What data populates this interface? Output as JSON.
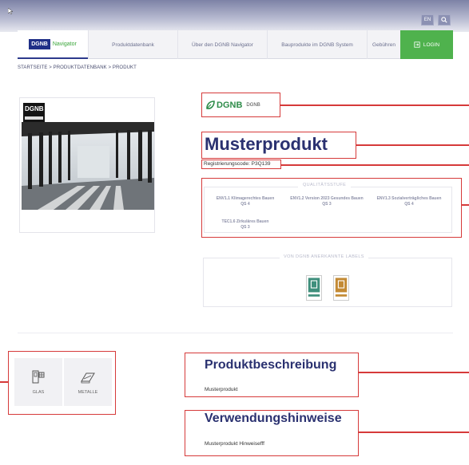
{
  "topbar": {
    "lang": "EN",
    "search_icon": "search-icon"
  },
  "nav": {
    "logo_text": "DGNB",
    "logo_sub": "Navigator",
    "items": [
      "Produktdatenbank",
      "Über den DGNB Navigator",
      "Bauprodukte im DGNB System",
      "Gebühren"
    ],
    "login": "LOGIN"
  },
  "breadcrumb": "STARTSEITE  >  PRODUKTDATENBANK  >  PRODUKT",
  "image_card": {
    "badge_text": "DGNB"
  },
  "brand": {
    "logo": "DGNB",
    "name": "DGNB"
  },
  "product": {
    "title": "Musterprodukt",
    "registration": "Registrierungscode: P3Q139"
  },
  "quality": {
    "label": "QUALITÄTSSTUFE",
    "items": [
      {
        "name": "ENV1.1 Klimagerechtes Bauen",
        "level": "QS 4"
      },
      {
        "name": "ENV1.2 Version 2023 Gesundes Bauen",
        "level": "QS 3"
      },
      {
        "name": "ENV1.3 Sozialverträgliches Bauen",
        "level": "QS 4"
      },
      {
        "name": "TEC1.6 Zirkuläres Bauen",
        "level": "QS 3"
      }
    ]
  },
  "labels": {
    "label": "VON DGNB ANERKANNTE LABELS"
  },
  "materials": [
    {
      "name": "GLAS",
      "icon": "glass-icon"
    },
    {
      "name": "METALLE",
      "icon": "metal-icon"
    }
  ],
  "description": {
    "title": "Produktbeschreibung",
    "text": "Musterprodukt"
  },
  "usage": {
    "title": "Verwendungshinweise",
    "text": "Musterprodukt Hinweisefff"
  },
  "colors": {
    "navy": "#2a3170",
    "green": "#4fb24d",
    "annotation_red": "#d63a3a"
  }
}
